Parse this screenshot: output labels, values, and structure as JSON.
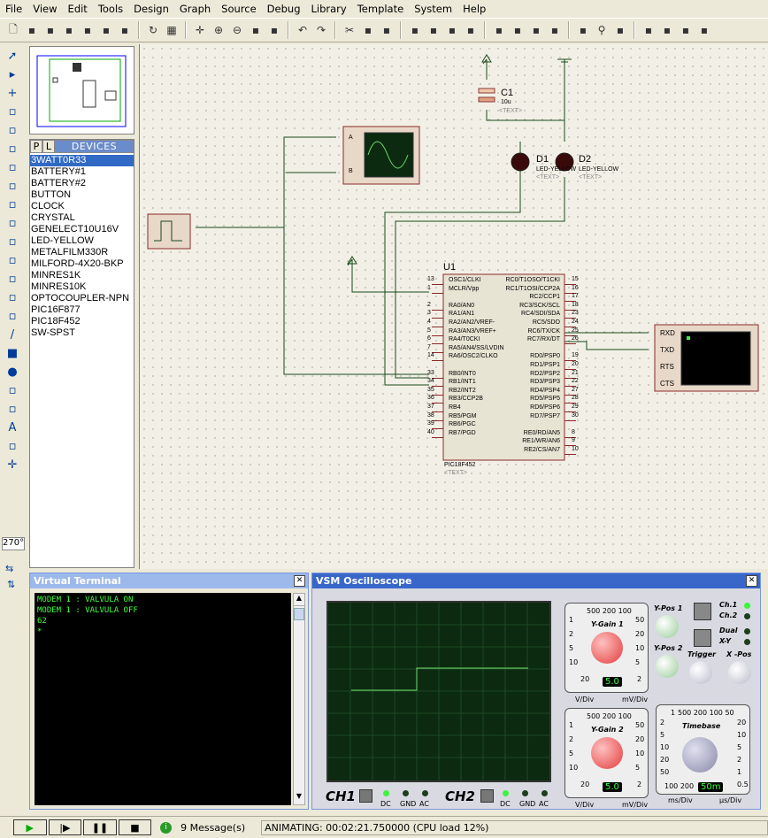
{
  "menu": [
    "File",
    "View",
    "Edit",
    "Tools",
    "Design",
    "Graph",
    "Source",
    "Debug",
    "Library",
    "Template",
    "System",
    "Help"
  ],
  "toolbar_icons": [
    "new-file-icon",
    "open-icon",
    "save-icon",
    "import-icon",
    "print-icon",
    "print-setup-icon",
    "page-icon",
    "|",
    "refresh-icon",
    "grid-icon",
    "|",
    "origin-icon",
    "zoom-in-icon",
    "zoom-out-icon",
    "zoom-all-icon",
    "zoom-area-icon",
    "|",
    "undo-icon",
    "redo-icon",
    "|",
    "cut-icon",
    "copy-icon",
    "paste-icon",
    "|",
    "block-copy-icon",
    "block-move-icon",
    "block-rotate-icon",
    "block-delete-icon",
    "|",
    "pick-device-icon",
    "make-device-icon",
    "package-icon",
    "decompose-icon",
    "|",
    "wire-autorouter-icon",
    "search-icon",
    "property-assign-icon",
    "|",
    "netlist-icon",
    "bill-of-materials-icon",
    "erc-icon",
    "ares-icon"
  ],
  "left_tools": [
    "selection-icon",
    "component-icon",
    "junction-icon",
    "wire-label-icon",
    "text-script-icon",
    "bus-icon",
    "subcircuit-icon",
    "terminal-icon",
    "device-pin-icon",
    "graph-icon",
    "tape-recorder-icon",
    "generator-icon",
    "voltage-probe-icon",
    "current-probe-icon",
    "virtual-instrument-icon",
    "line-icon",
    "box-icon",
    "circle-icon",
    "arc-icon",
    "path-icon",
    "text-icon",
    "symbol-icon",
    "marker-icon"
  ],
  "rotation": "270°",
  "devices": {
    "tab_p": "P",
    "tab_l": "L",
    "header": "DEVICES",
    "selected": 0,
    "items": [
      "3WATT0R33",
      "BATTERY#1",
      "BATTERY#2",
      "BUTTON",
      "CLOCK",
      "CRYSTAL",
      "GENELECT10U16V",
      "LED-YELLOW",
      "METALFILM330R",
      "MILFORD-4X20-BKP",
      "MINRES1K",
      "MINRES10K",
      "OPTOCOUPLER-NPN",
      "PIC16F877",
      "PIC18F452",
      "SW-SPST"
    ]
  },
  "schematic": {
    "c1": {
      "ref": "C1",
      "value": "10u",
      "text": "<TEXT>"
    },
    "d1": {
      "ref": "D1",
      "value": "LED-YELLOW",
      "text": "<TEXT>"
    },
    "d2": {
      "ref": "D2",
      "value": "LED-YELLOW",
      "text": "<TEXT>"
    },
    "scope_inputs": [
      "A",
      "B"
    ],
    "u1": {
      "ref": "U1",
      "part": "PIC18F452",
      "text": "<TEXT>",
      "left_pins": [
        [
          "13",
          "OSC1/CLKI"
        ],
        [
          "1",
          "MCLR/Vpp"
        ],
        [
          "",
          ""
        ],
        [
          "2",
          "RA0/AN0"
        ],
        [
          "3",
          "RA1/AN1"
        ],
        [
          "4",
          "RA2/AN2/VREF-"
        ],
        [
          "5",
          "RA3/AN3/VREF+"
        ],
        [
          "6",
          "RA4/T0CKI"
        ],
        [
          "7",
          "RA5/AN4/SS/LVDIN"
        ],
        [
          "14",
          "RA6/OSC2/CLKO"
        ],
        [
          "",
          ""
        ],
        [
          "33",
          "RB0/INT0"
        ],
        [
          "34",
          "RB1/INT1"
        ],
        [
          "35",
          "RB2/INT2"
        ],
        [
          "36",
          "RB3/CCP2B"
        ],
        [
          "37",
          "RB4"
        ],
        [
          "38",
          "RB5/PGM"
        ],
        [
          "39",
          "RB6/PGC"
        ],
        [
          "40",
          "RB7/PGD"
        ]
      ],
      "right_pins": [
        [
          "15",
          "RC0/T1OSO/T1CKI"
        ],
        [
          "16",
          "RC1/T1OSI/CCP2A"
        ],
        [
          "17",
          "RC2/CCP1"
        ],
        [
          "18",
          "RC3/SCK/SCL"
        ],
        [
          "23",
          "RC4/SDI/SDA"
        ],
        [
          "24",
          "RC5/SDO"
        ],
        [
          "25",
          "RC6/TX/CK"
        ],
        [
          "26",
          "RC7/RX/DT"
        ],
        [
          "",
          ""
        ],
        [
          "19",
          "RD0/PSP0"
        ],
        [
          "20",
          "RD1/PSP1"
        ],
        [
          "21",
          "RD2/PSP2"
        ],
        [
          "22",
          "RD3/PSP3"
        ],
        [
          "27",
          "RD4/PSP4"
        ],
        [
          "28",
          "RD5/PSP5"
        ],
        [
          "29",
          "RD6/PSP6"
        ],
        [
          "30",
          "RD7/PSP7"
        ],
        [
          "",
          ""
        ],
        [
          "8",
          "RE0/RD/AN5"
        ],
        [
          "9",
          "RE1/WR/AN6"
        ],
        [
          "10",
          "RE2/CS/AN7"
        ]
      ]
    },
    "vterm_pins": [
      "RXD",
      "TXD",
      "RTS",
      "CTS"
    ]
  },
  "terminal": {
    "title": "Virtual Terminal",
    "lines": [
      "MODEM 1 : VALVULA ON",
      "MODEM 1 : VALVULA OFF",
      "62",
      "*"
    ]
  },
  "scope": {
    "title": "VSM Oscilloscope",
    "ch1": "CH1",
    "ch2": "CH2",
    "coupling": [
      "DC",
      "GND",
      "AC"
    ],
    "ygain1": "Y-Gain 1",
    "ygain2": "Y-Gain 2",
    "timebase": "Timebase",
    "ypos1": "Y-Pos 1",
    "ypos2": "Y-Pos 2",
    "trigger": "Trigger",
    "xpos": "X -Pos",
    "ch1_led": "Ch.1",
    "ch2_led": "Ch.2",
    "dual": "Dual",
    "xy": "X-Y",
    "y_top": "500 200 100",
    "y_left": [
      "1",
      "2",
      "5",
      "10"
    ],
    "y_bottom_left": "20",
    "y_right": [
      "50",
      "20",
      "10",
      "5"
    ],
    "y_bottom_right": "2",
    "vdiv": "V/Div",
    "mvdiv": "mV/Div",
    "ygain1_value": "5.0",
    "ygain2_value": "5.0",
    "tb_top": "500 200 100 50",
    "tb_one": "1",
    "tb_left": [
      "2",
      "5",
      "10",
      "20",
      "50"
    ],
    "tb_bottom_left": "100 200",
    "tb_right": [
      "20",
      "10",
      "5",
      "2",
      "1",
      "0.5"
    ],
    "tb_value": "50m",
    "msdiv": "ms/Div",
    "usdiv": "µs/Div",
    "trace_color": "#6fdc6f",
    "led_on": "#3df33d"
  },
  "status": {
    "messages": "9 Message(s)",
    "animating": "ANIMATING: 00:02:21.750000 (CPU load 12%)"
  }
}
